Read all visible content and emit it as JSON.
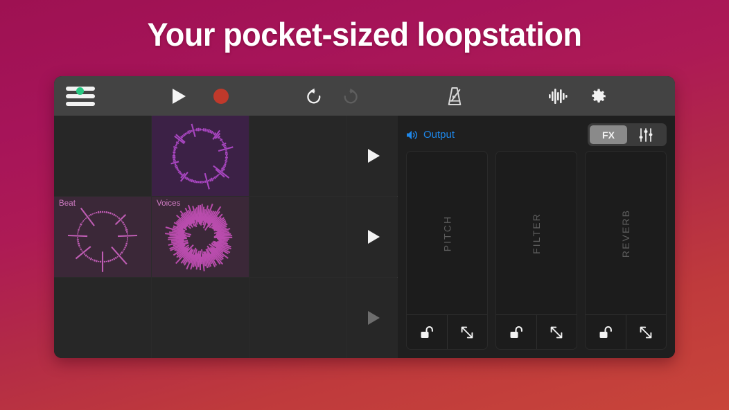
{
  "headline": "Your pocket-sized loopstation",
  "colors": {
    "bg_top": "#9e1152",
    "bg_bottom": "#c8453a",
    "accent_blue": "#1f87e8",
    "record_red": "#c0392b",
    "menu_dot_green": "#28c882",
    "loop_purple": "#3c2146",
    "loop_mauve": "#3b2838",
    "wave_pink": "#b452a8"
  },
  "toolbar": {
    "menu_icon": "hamburger-menu-icon",
    "menu_indicator": "green-dot",
    "play_label": "Play",
    "play_icon": "play-icon",
    "record_label": "Record",
    "record_icon": "record-icon",
    "undo_label": "Undo",
    "undo_icon": "undo-icon",
    "undo_enabled": "true",
    "redo_label": "Redo",
    "redo_icon": "redo-icon",
    "redo_enabled": "false",
    "metronome_label": "Metronome",
    "metronome_icon": "metronome-icon",
    "waveform_label": "Waveform",
    "waveform_icon": "audio-waveform-icon",
    "settings_label": "Settings",
    "settings_icon": "gear-icon"
  },
  "grid": {
    "rows": [
      {
        "cells": [
          {
            "label": "",
            "state": "empty",
            "style": "empty"
          },
          {
            "label": "",
            "state": "filled",
            "style": "filled-a",
            "wave": "circular-waveform"
          },
          {
            "label": "",
            "state": "empty",
            "style": "empty"
          }
        ],
        "play_label": "Play row 1",
        "play_enabled": "true"
      },
      {
        "cells": [
          {
            "label": "Beat",
            "state": "filled",
            "style": "filled-b",
            "wave": "circular-waveform-sparse"
          },
          {
            "label": "Voices",
            "state": "filled",
            "style": "filled-b",
            "wave": "circular-waveform-dense"
          },
          {
            "label": "",
            "state": "empty",
            "style": "empty"
          }
        ],
        "play_label": "Play row 2",
        "play_enabled": "true"
      },
      {
        "cells": [
          {
            "label": "",
            "state": "empty",
            "style": "empty"
          },
          {
            "label": "",
            "state": "empty",
            "style": "empty"
          },
          {
            "label": "",
            "state": "empty",
            "style": "empty"
          }
        ],
        "play_label": "Play row 3",
        "play_enabled": "false"
      }
    ]
  },
  "fx_panel": {
    "output_label": "Output",
    "speaker_icon": "speaker-icon",
    "segment": {
      "fx_label": "FX",
      "fx_selected": "true",
      "sliders_icon": "mixer-sliders-icon",
      "sliders_selected": "false"
    },
    "columns": [
      {
        "name": "PITCH",
        "lock_icon": "unlock-icon",
        "expand_icon": "expand-diagonal-icon"
      },
      {
        "name": "FILTER",
        "lock_icon": "unlock-icon",
        "expand_icon": "expand-diagonal-icon"
      },
      {
        "name": "REVERB",
        "lock_icon": "unlock-icon",
        "expand_icon": "expand-diagonal-icon"
      }
    ]
  }
}
